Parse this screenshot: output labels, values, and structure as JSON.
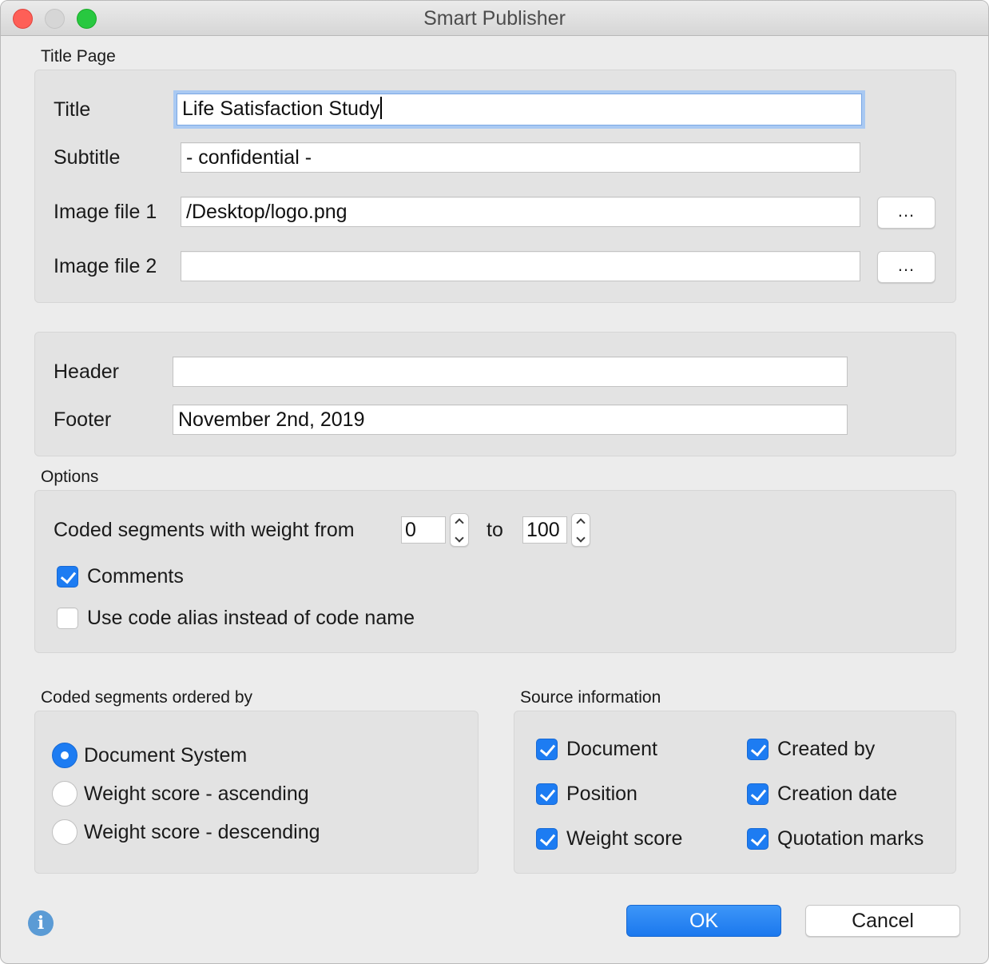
{
  "window": {
    "title": "Smart Publisher"
  },
  "title_page": {
    "section_label": "Title Page",
    "title_label": "Title",
    "title_value": "Life Satisfaction Study",
    "subtitle_label": "Subtitle",
    "subtitle_value": "- confidential -",
    "image1_label": "Image file 1",
    "image1_value": "/Desktop/logo.png",
    "image2_label": "Image file 2",
    "image2_value": "",
    "browse_label": "..."
  },
  "header_footer": {
    "header_label": "Header",
    "header_value": "",
    "footer_label": "Footer",
    "footer_value": "November 2nd, 2019"
  },
  "options": {
    "section_label": "Options",
    "weight_label": "Coded segments with weight from",
    "weight_from": "0",
    "to_label": "to",
    "weight_to": "100",
    "comments_label": "Comments",
    "comments_checked": true,
    "alias_label": "Use code alias instead of code name",
    "alias_checked": false
  },
  "ordering": {
    "section_label": "Coded segments ordered by",
    "options": [
      {
        "label": "Document System",
        "selected": true
      },
      {
        "label": "Weight score - ascending",
        "selected": false
      },
      {
        "label": "Weight score - descending",
        "selected": false
      }
    ]
  },
  "source_info": {
    "section_label": "Source information",
    "items": [
      {
        "label": "Document",
        "checked": true
      },
      {
        "label": "Created by",
        "checked": true
      },
      {
        "label": "Position",
        "checked": true
      },
      {
        "label": "Creation date",
        "checked": true
      },
      {
        "label": "Weight score",
        "checked": true
      },
      {
        "label": "Quotation marks",
        "checked": true
      }
    ]
  },
  "buttons": {
    "ok": "OK",
    "cancel": "Cancel"
  },
  "icons": {
    "info": "info-icon"
  },
  "colors": {
    "accent": "#1d7cf2",
    "info": "#5b9bd5"
  }
}
